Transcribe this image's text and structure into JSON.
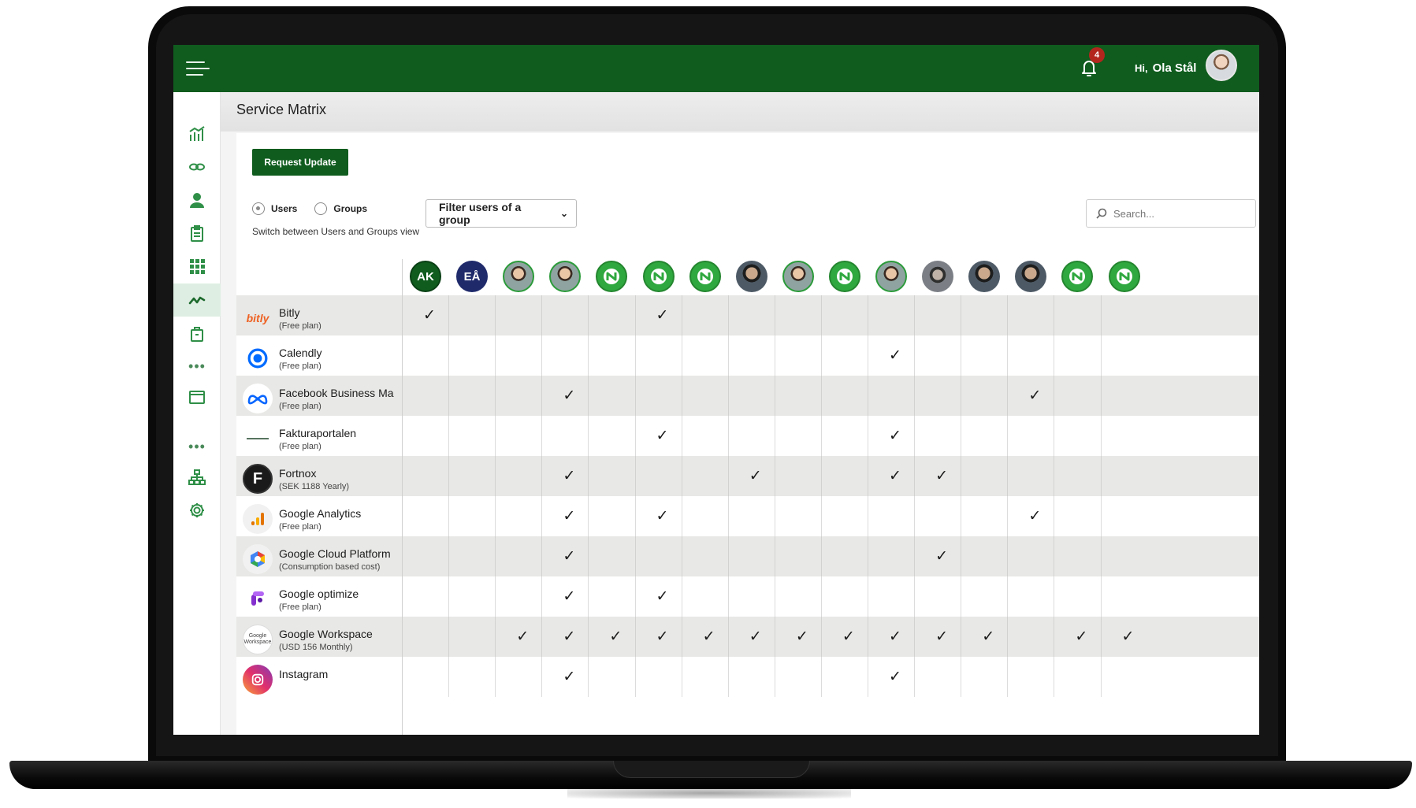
{
  "header": {
    "notification_count": "4",
    "greeting_hi": "Hi,",
    "user_name": "Ola Stål"
  },
  "page": {
    "title": "Service Matrix",
    "request_update_label": "Request Update",
    "radio_users_label": "Users",
    "radio_groups_label": "Groups",
    "switch_hint": "Switch between Users and Groups view",
    "filter_label": "Filter users of a group",
    "search_placeholder": "Search..."
  },
  "sidebar": {
    "items": [
      {
        "icon": "bar-chart-icon"
      },
      {
        "icon": "link-chain-icon"
      },
      {
        "icon": "user-icon"
      },
      {
        "icon": "clipboard-icon"
      },
      {
        "icon": "grid-apps-icon"
      },
      {
        "icon": "trend-line-icon",
        "active": true
      },
      {
        "icon": "box-icon"
      },
      {
        "icon": "browser-window-icon"
      },
      {
        "icon": "org-chart-icon"
      },
      {
        "icon": "gear-icon"
      }
    ]
  },
  "users": [
    {
      "type": "initials",
      "label": "AK",
      "color": "#0f5c1e"
    },
    {
      "type": "initials",
      "label": "EÅ",
      "color": "#1f2a6b"
    },
    {
      "type": "photo"
    },
    {
      "type": "photo"
    },
    {
      "type": "logo"
    },
    {
      "type": "logo"
    },
    {
      "type": "logo"
    },
    {
      "type": "photo-dark"
    },
    {
      "type": "photo"
    },
    {
      "type": "logo"
    },
    {
      "type": "photo"
    },
    {
      "type": "photo-gray"
    },
    {
      "type": "photo-dark"
    },
    {
      "type": "photo-dark"
    },
    {
      "type": "logo"
    },
    {
      "type": "logo"
    }
  ],
  "services": [
    {
      "name": "Bitly",
      "plan": "(Free plan)",
      "logo": "bitly",
      "checks": [
        0,
        5
      ]
    },
    {
      "name": "Calendly",
      "plan": "(Free plan)",
      "logo": "calendly",
      "checks": [
        10
      ]
    },
    {
      "name": "Facebook Business Ma",
      "plan": "(Free plan)",
      "logo": "meta",
      "checks": [
        3,
        13
      ]
    },
    {
      "name": "Fakturaportalen",
      "plan": "(Free plan)",
      "logo": "fakturaportalen",
      "checks": [
        5,
        10
      ]
    },
    {
      "name": "Fortnox",
      "plan": "(SEK 1188 Yearly)",
      "logo": "fortnox",
      "checks": [
        3,
        7,
        10,
        11
      ]
    },
    {
      "name": "Google Analytics",
      "plan": "(Free plan)",
      "logo": "google-analytics",
      "checks": [
        3,
        5,
        13
      ]
    },
    {
      "name": "Google Cloud Platform",
      "plan": "(Consumption based cost)",
      "logo": "google-cloud",
      "checks": [
        3,
        11
      ]
    },
    {
      "name": "Google optimize",
      "plan": "(Free plan)",
      "logo": "google-optimize",
      "checks": [
        3,
        5
      ]
    },
    {
      "name": "Google Workspace",
      "plan": "(USD 156 Monthly)",
      "logo": "google-workspace",
      "checks": [
        2,
        3,
        4,
        5,
        6,
        7,
        8,
        9,
        10,
        11,
        12,
        14,
        15
      ]
    },
    {
      "name": "Instagram",
      "plan": "",
      "logo": "instagram",
      "checks": [
        3,
        10
      ]
    }
  ],
  "check_glyph": "✓",
  "colors": {
    "brand_green": "#0f5c1e",
    "accent_green": "#2f8f47",
    "badge_red": "#b3261e"
  }
}
